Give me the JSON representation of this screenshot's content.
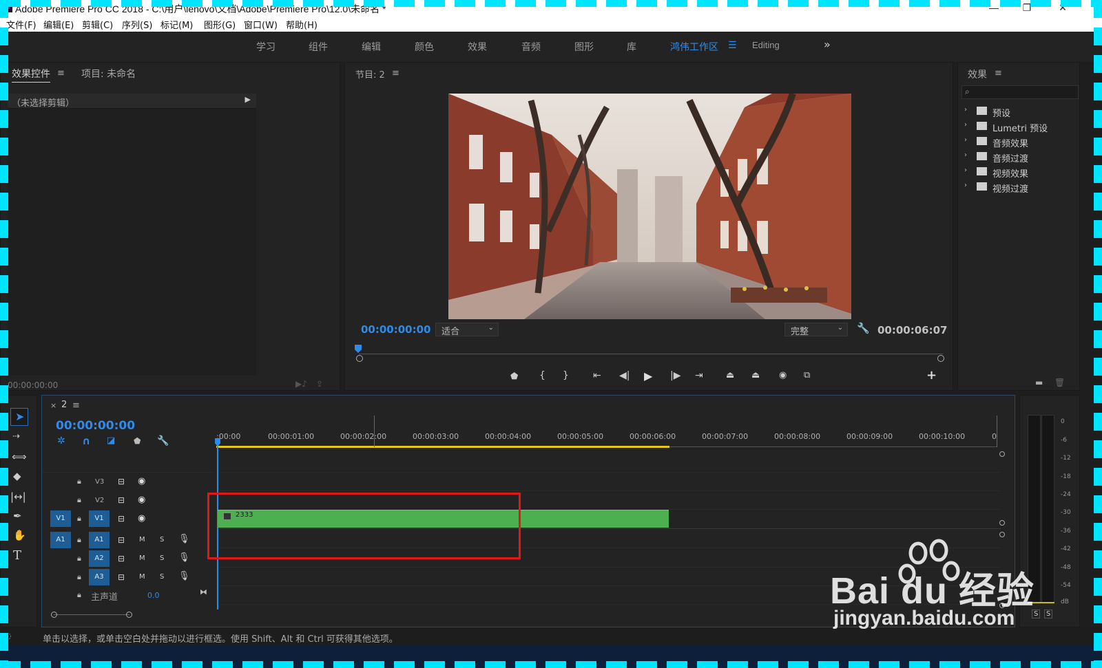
{
  "window": {
    "title": "Adobe Premiere Pro CC 2018 - C:\\用户\\lenovo\\文档\\Adobe\\Premiere Pro\\12.0\\未命名 *",
    "app_icon": "Pr"
  },
  "menu": [
    "文件(F)",
    "编辑(E)",
    "剪辑(C)",
    "序列(S)",
    "标记(M)",
    "图形(G)",
    "窗口(W)",
    "帮助(H)"
  ],
  "workspaces": {
    "items": [
      "学习",
      "组件",
      "编辑",
      "颜色",
      "效果",
      "音频",
      "图形",
      "库"
    ],
    "active": "鸿伟工作区",
    "extra": "Editing"
  },
  "source_panel": {
    "tab_effect_controls": "效果控件",
    "tab_project": "项目: 未命名",
    "no_clip": "（未选择剪辑）",
    "timecode": "00:00:00:00"
  },
  "program_monitor": {
    "tab": "节目: 2",
    "current_time": "00:00:00:00",
    "fit": "适合",
    "quality": "完整",
    "duration": "00:00:06:07"
  },
  "effects_panel": {
    "title": "效果",
    "items": [
      "预设",
      "Lumetri 预设",
      "音频效果",
      "音频过渡",
      "视频效果",
      "视频过渡"
    ]
  },
  "timeline": {
    "sequence_name": "2",
    "timecode": "00:00:00:00",
    "ruler": [
      ":00:00",
      "00:00:01:00",
      "00:00:02:00",
      "00:00:03:00",
      "00:00:04:00",
      "00:00:05:00",
      "00:00:06:00",
      "00:00:07:00",
      "00:00:08:00",
      "00:00:09:00",
      "00:00:10:00",
      "0"
    ],
    "video_tracks": [
      "V3",
      "V2",
      "V1"
    ],
    "audio_tracks": [
      "A1",
      "A2",
      "A3"
    ],
    "source_v": "V1",
    "source_a": "A1",
    "master_label": "主声道",
    "master_value": "0.0",
    "mute": "M",
    "solo": "S",
    "clip_name": "2333",
    "clip_color": "#4caf50"
  },
  "audio_meter": {
    "ticks": [
      "0",
      "-6",
      "-12",
      "-18",
      "-24",
      "-30",
      "-36",
      "-42",
      "-48",
      "-54",
      "dB"
    ],
    "solo": "S"
  },
  "status_bar": {
    "text": "单击以选择，或单击空白处并拖动以进行框选。使用 Shift、Alt 和 Ctrl 可获得其他选项。"
  },
  "watermark": {
    "brand": "Bai du 经验",
    "url": "jingyan.baidu.com"
  },
  "colors": {
    "accent": "#2d8ceb",
    "highlight_box": "#e01818",
    "workarea": "#e6c619"
  }
}
